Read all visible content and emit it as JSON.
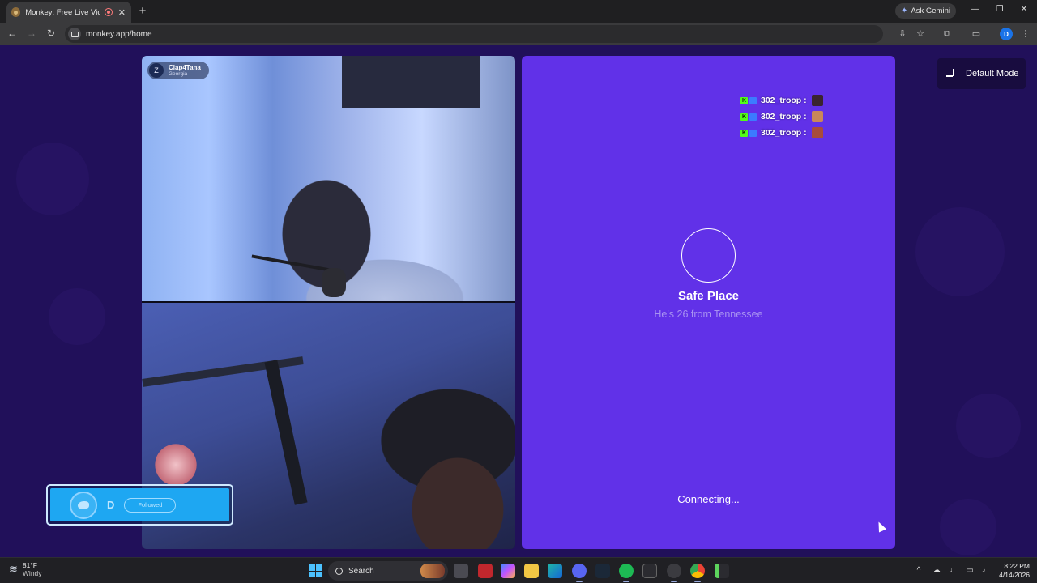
{
  "browser": {
    "tab_title": "Monkey: Free Live Video Ch",
    "new_tab": "+",
    "ask_gemini": "Ask Gemini",
    "url": "monkey.app/home",
    "profile_initial": "D"
  },
  "video": {
    "user_initial": "Z",
    "username": "Clap4Tana",
    "location": "Georgia"
  },
  "twitter_widget": {
    "letter": "D",
    "followed_label": "Followed"
  },
  "chat": {
    "badge": "K",
    "messages": [
      {
        "user": "302_troop :",
        "emote_color": "#3a2430"
      },
      {
        "user": "302_troop :",
        "emote_color": "#c9875a"
      },
      {
        "user": "302_troop :",
        "emote_color": "#a84c3c"
      }
    ]
  },
  "connect": {
    "title": "Safe Place",
    "subtitle": "He's 26 from Tennessee",
    "status": "Connecting..."
  },
  "mode_button": {
    "label": "Default Mode"
  },
  "taskbar": {
    "temp": "81°F",
    "condition": "Windy",
    "search_label": "Search",
    "time": "8:22 PM",
    "date": "4/14/2026",
    "apps": [
      "task-view",
      "adobe-acrobat",
      "copilot",
      "file-explorer",
      "edge",
      "discord",
      "steam",
      "spotify",
      "xbox",
      "chatgpt",
      "chrome",
      "game-app"
    ]
  },
  "colors": {
    "page_bg": "#21105a",
    "panel_purple": "#6131e8",
    "twitter_blue": "#1ea7f2",
    "kick_green": "#53fc18"
  }
}
